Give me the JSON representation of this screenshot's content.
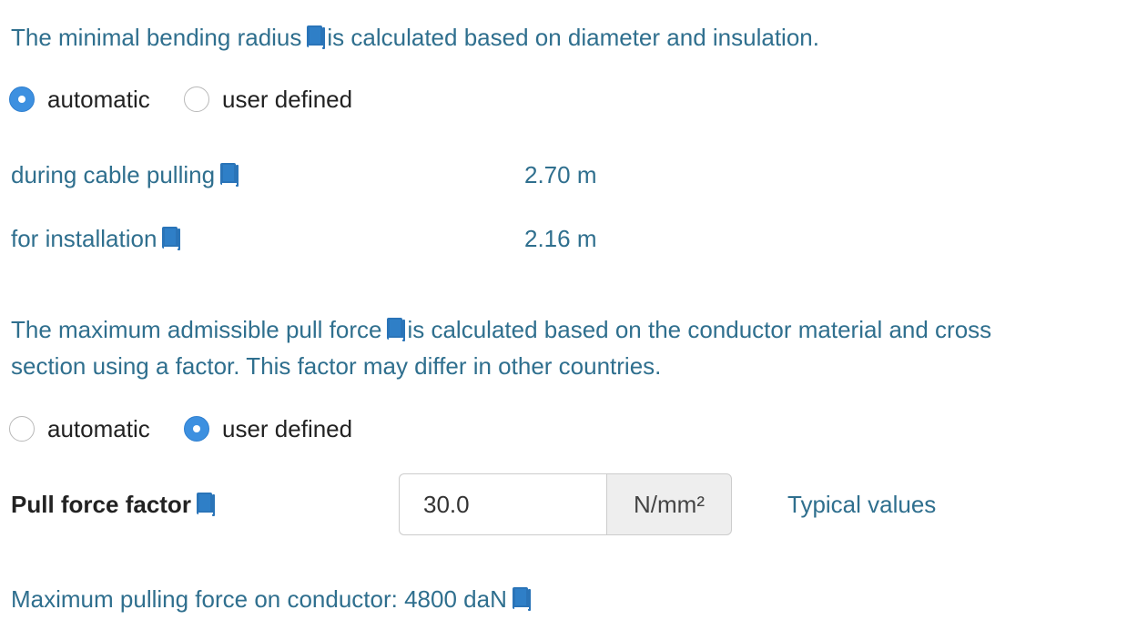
{
  "bending_radius": {
    "intro_before": "The minimal bending radius",
    "intro_after": "is calculated based on diameter and insulation.",
    "mode_automatic_label": "automatic",
    "mode_user_label": "user defined",
    "selected_mode": "automatic",
    "rows": [
      {
        "label": "during cable pulling",
        "value": "2.70 m"
      },
      {
        "label": "for installation",
        "value": "2.16 m"
      }
    ]
  },
  "pull_force": {
    "intro_before": "The maximum admissible pull force",
    "intro_after_line1": "is calculated based on the conductor material and cross",
    "intro_line2": "section using a factor. This factor may differ in other countries.",
    "mode_automatic_label": "automatic",
    "mode_user_label": "user defined",
    "selected_mode": "user defined",
    "factor_label": "Pull force factor",
    "factor_value": "30.0",
    "factor_unit": "N/mm²",
    "typical_values_link": "Typical values",
    "max_force_text": "Maximum pulling force on conductor: 4800 daN"
  },
  "icons": {
    "info": "book-icon"
  },
  "colors": {
    "text_blue": "#2f6f8e",
    "radio_checked": "#3d90e0",
    "icon_blue": "#2a74b8"
  }
}
